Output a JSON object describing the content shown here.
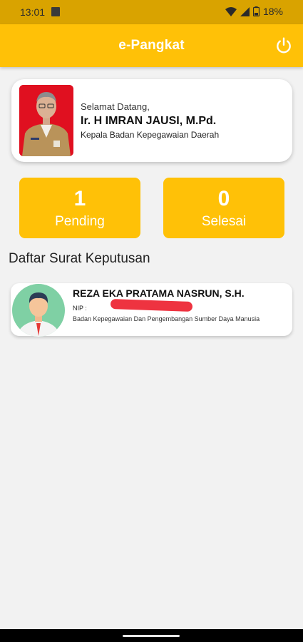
{
  "status_bar": {
    "time": "13:01",
    "battery": "18%"
  },
  "app_bar": {
    "title": "e-Pangkat",
    "logout_icon": "power-icon"
  },
  "profile": {
    "greeting": "Selamat Datang,",
    "name": "Ir. H IMRAN JAUSI, M.Pd.",
    "position": "Kepala Badan Kepegawaian Daerah"
  },
  "stats": {
    "pending": {
      "count": "1",
      "label": "Pending"
    },
    "done": {
      "count": "0",
      "label": "Selesai"
    }
  },
  "section_title": "Daftar Surat Keputusan",
  "decrees": [
    {
      "name": "REZA EKA PRATAMA NASRUN, S.H.",
      "nip_label": "NIP :",
      "unit": "Badan Kepegawaian Dan Pengembangan Sumber Daya Manusia"
    }
  ],
  "colors": {
    "primary": "#ffc107",
    "status_bar": "#d9a300",
    "photo_background": "#e01020"
  }
}
